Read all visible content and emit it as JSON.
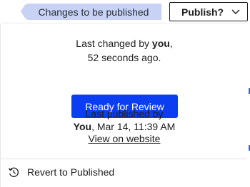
{
  "topbar": {
    "status_label": "Changes to be published",
    "publish_label": "Publish?"
  },
  "panel": {
    "last_changed_prefix": "Last changed by ",
    "last_changed_user": "you",
    "last_changed_suffix": ",",
    "last_changed_time": "52 seconds ago.",
    "review_button_label": "Ready for Review",
    "last_published_label": "Last published by",
    "last_published_user": "You",
    "last_published_date": ", Mar 14, 11:39 AM",
    "view_link_label": "View on website",
    "revert_label": "Revert to Published"
  },
  "colors": {
    "status_pill": "#c7d2f4",
    "primary_button": "#0b3ef0",
    "edge_accent": "#3a66d8"
  }
}
